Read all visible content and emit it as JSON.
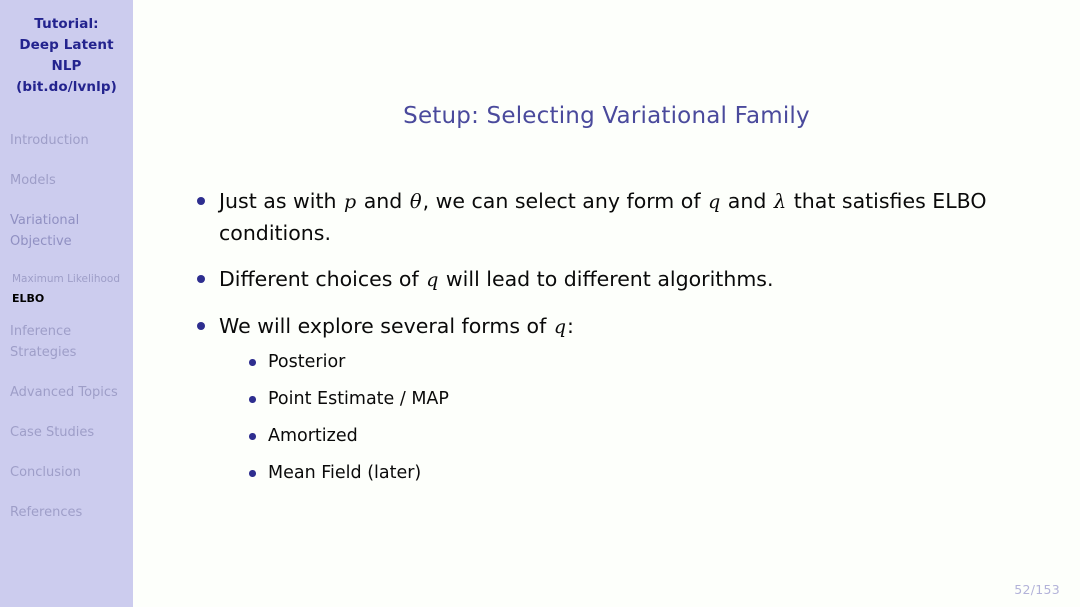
{
  "sidebar": {
    "header": {
      "line1": "Tutorial:",
      "line2": "Deep Latent NLP",
      "line3": "(bit.do/lvnlp)"
    },
    "sections": [
      {
        "label": "Introduction",
        "active": false
      },
      {
        "label": "Models",
        "active": false
      },
      {
        "label": "Variational Objective",
        "active": true
      },
      {
        "label": "Inference Strategies",
        "active": false
      },
      {
        "label": "Advanced Topics",
        "active": false
      },
      {
        "label": "Case Studies",
        "active": false
      },
      {
        "label": "Conclusion",
        "active": false
      },
      {
        "label": "References",
        "active": false
      }
    ],
    "subsections": [
      {
        "label": "Maximum Likelihood",
        "active": false
      },
      {
        "label": "ELBO",
        "active": true
      }
    ]
  },
  "slide": {
    "title": "Setup: Selecting Variational Family",
    "bullets": [
      {
        "parts": [
          {
            "type": "text",
            "value": "Just as with "
          },
          {
            "type": "math",
            "value": "p"
          },
          {
            "type": "text",
            "value": " and "
          },
          {
            "type": "greek",
            "value": "θ"
          },
          {
            "type": "text",
            "value": ", we can select any form of "
          },
          {
            "type": "math",
            "value": "q"
          },
          {
            "type": "text",
            "value": " and "
          },
          {
            "type": "greek",
            "value": "λ"
          },
          {
            "type": "text",
            "value": " that satisfies ELBO conditions."
          }
        ]
      },
      {
        "parts": [
          {
            "type": "text",
            "value": "Different choices of "
          },
          {
            "type": "math",
            "value": "q"
          },
          {
            "type": "text",
            "value": " will lead to different algorithms."
          }
        ]
      },
      {
        "parts": [
          {
            "type": "text",
            "value": "We will explore several forms of "
          },
          {
            "type": "math",
            "value": "q"
          },
          {
            "type": "text",
            "value": ":"
          }
        ],
        "subitems": [
          "Posterior",
          "Point Estimate / MAP",
          "Amortized",
          "Mean Field (later)"
        ]
      }
    ],
    "page_number": "52/153"
  },
  "colors": {
    "sidebar_background": "#ccccee",
    "sidebar_header_text": "#23238e",
    "sidebar_inactive_text": "#9e9ec8",
    "sidebar_active_text": "#000000",
    "title_text": "#4a4a9c",
    "bullet_marker": "#2e2e8f",
    "body_text": "#0a0a0a",
    "page_number_text": "#b3b3d9",
    "main_background": "#fdfffb"
  }
}
